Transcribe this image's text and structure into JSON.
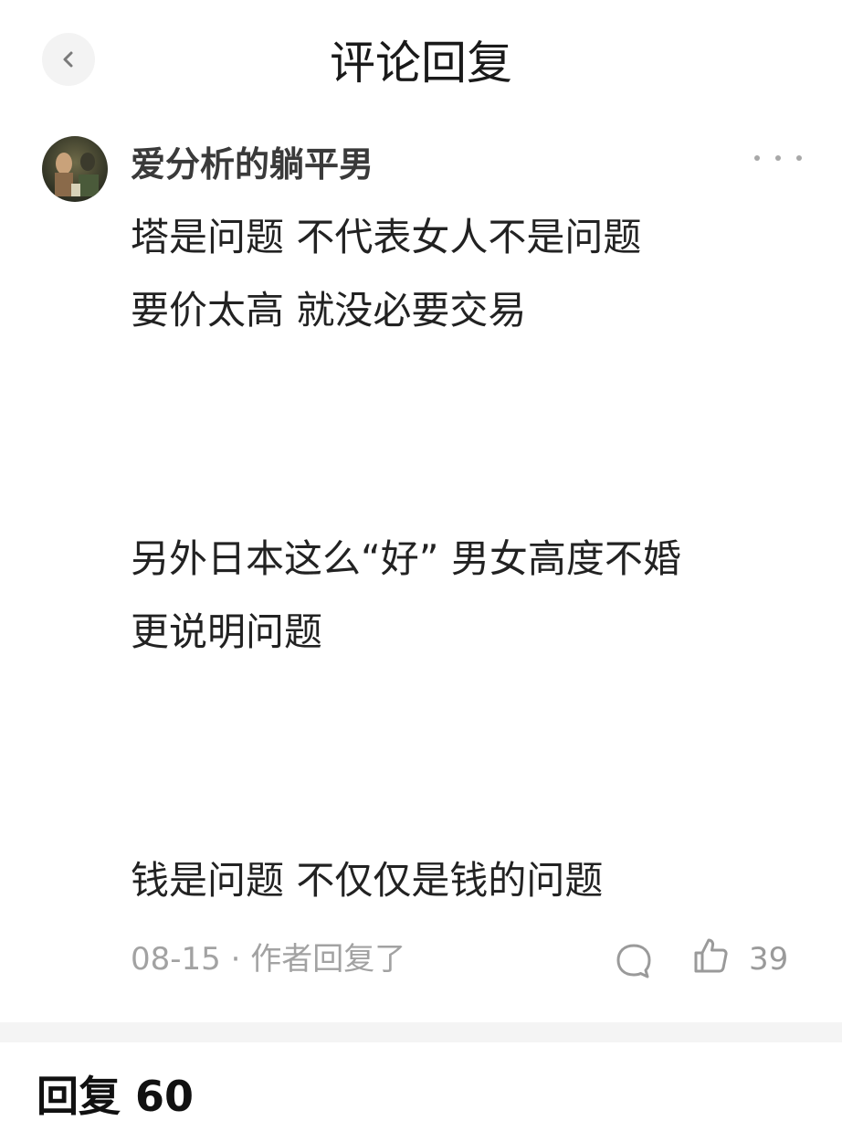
{
  "header": {
    "title": "评论回复",
    "back_icon": "chevron-left-icon"
  },
  "comment": {
    "username": "爱分析的躺平男",
    "more_icon": "more-horizontal-icon",
    "lines": [
      "塔是问题 不代表女人不是问题",
      "要价太高 就没必要交易",
      "另外日本这么“好” 男女高度不婚",
      "更说明问题",
      "钱是问题 不仅仅是钱的问题"
    ],
    "date": "08-15",
    "separator": "·",
    "author_replied": "作者回复了",
    "reply_icon": "comment-bubble-icon",
    "like_icon": "thumbs-up-icon",
    "like_count": "39"
  },
  "replies": {
    "label": "回复",
    "count": "60"
  },
  "colors": {
    "background": "#ffffff",
    "text_primary": "#222222",
    "text_secondary": "#a2a2a2",
    "divider": "#f4f4f4"
  }
}
